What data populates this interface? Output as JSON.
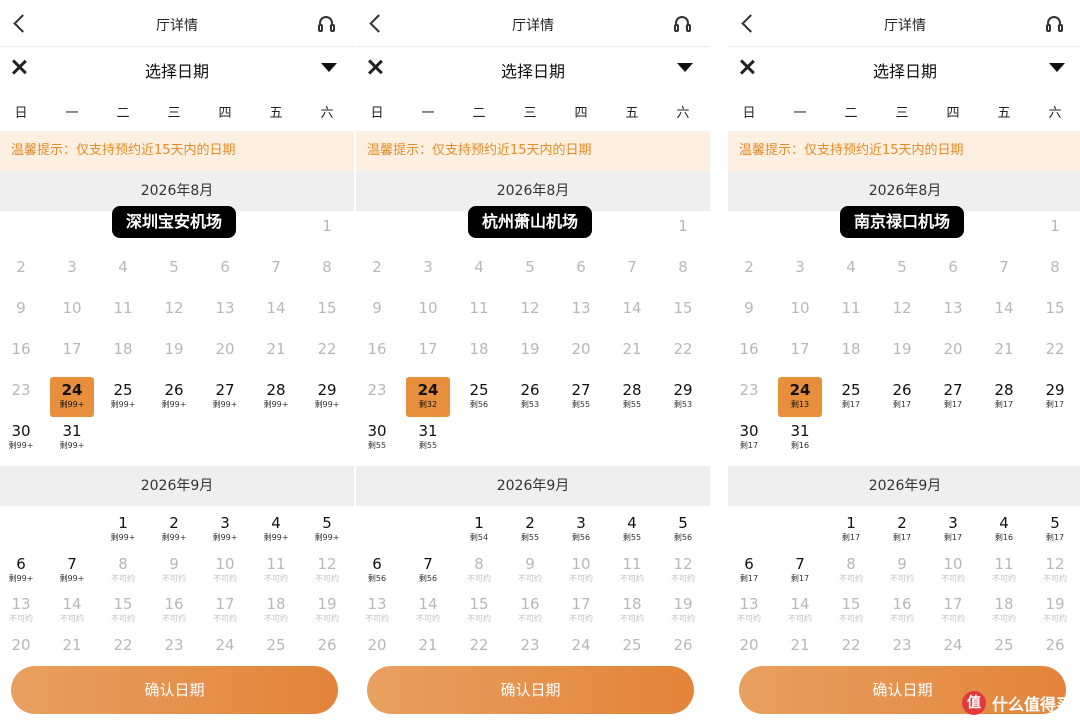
{
  "common": {
    "top_title": "厅详情",
    "select_title": "选择日期",
    "weekdays": [
      "日",
      "一",
      "二",
      "三",
      "四",
      "五",
      "六"
    ],
    "notice": "温馨提示：仅支持预约近15天内的日期",
    "months": [
      "2026年8月",
      "2026年9月"
    ],
    "confirm_label": "确认日期",
    "unavailable_label": "不可约",
    "remaining_prefix": "剩",
    "selected_day": 24,
    "accent_color": "#e88f3e",
    "notice_color": "#e48c28"
  },
  "panels": [
    {
      "airport": "深圳宝安机场",
      "aug_remaining": [
        "99+",
        "99+",
        "99+",
        "99+",
        "99+",
        "99+",
        "99+",
        "99+"
      ],
      "sep_remaining": [
        "99+",
        "99+",
        "99+",
        "99+",
        "99+",
        "99+",
        "99+"
      ]
    },
    {
      "airport": "杭州萧山机场",
      "aug_remaining": [
        "32",
        "56",
        "53",
        "55",
        "55",
        "53",
        "55",
        "55"
      ],
      "sep_remaining": [
        "54",
        "55",
        "56",
        "55",
        "56",
        "56",
        "56"
      ]
    },
    {
      "airport": "南京禄口机场",
      "aug_remaining": [
        "13",
        "17",
        "17",
        "17",
        "17",
        "17",
        "17",
        "16"
      ],
      "sep_remaining": [
        "17",
        "17",
        "17",
        "16",
        "17",
        "17",
        "17"
      ]
    }
  ],
  "watermark": {
    "logo_char": "值",
    "text": "什么值得买"
  }
}
